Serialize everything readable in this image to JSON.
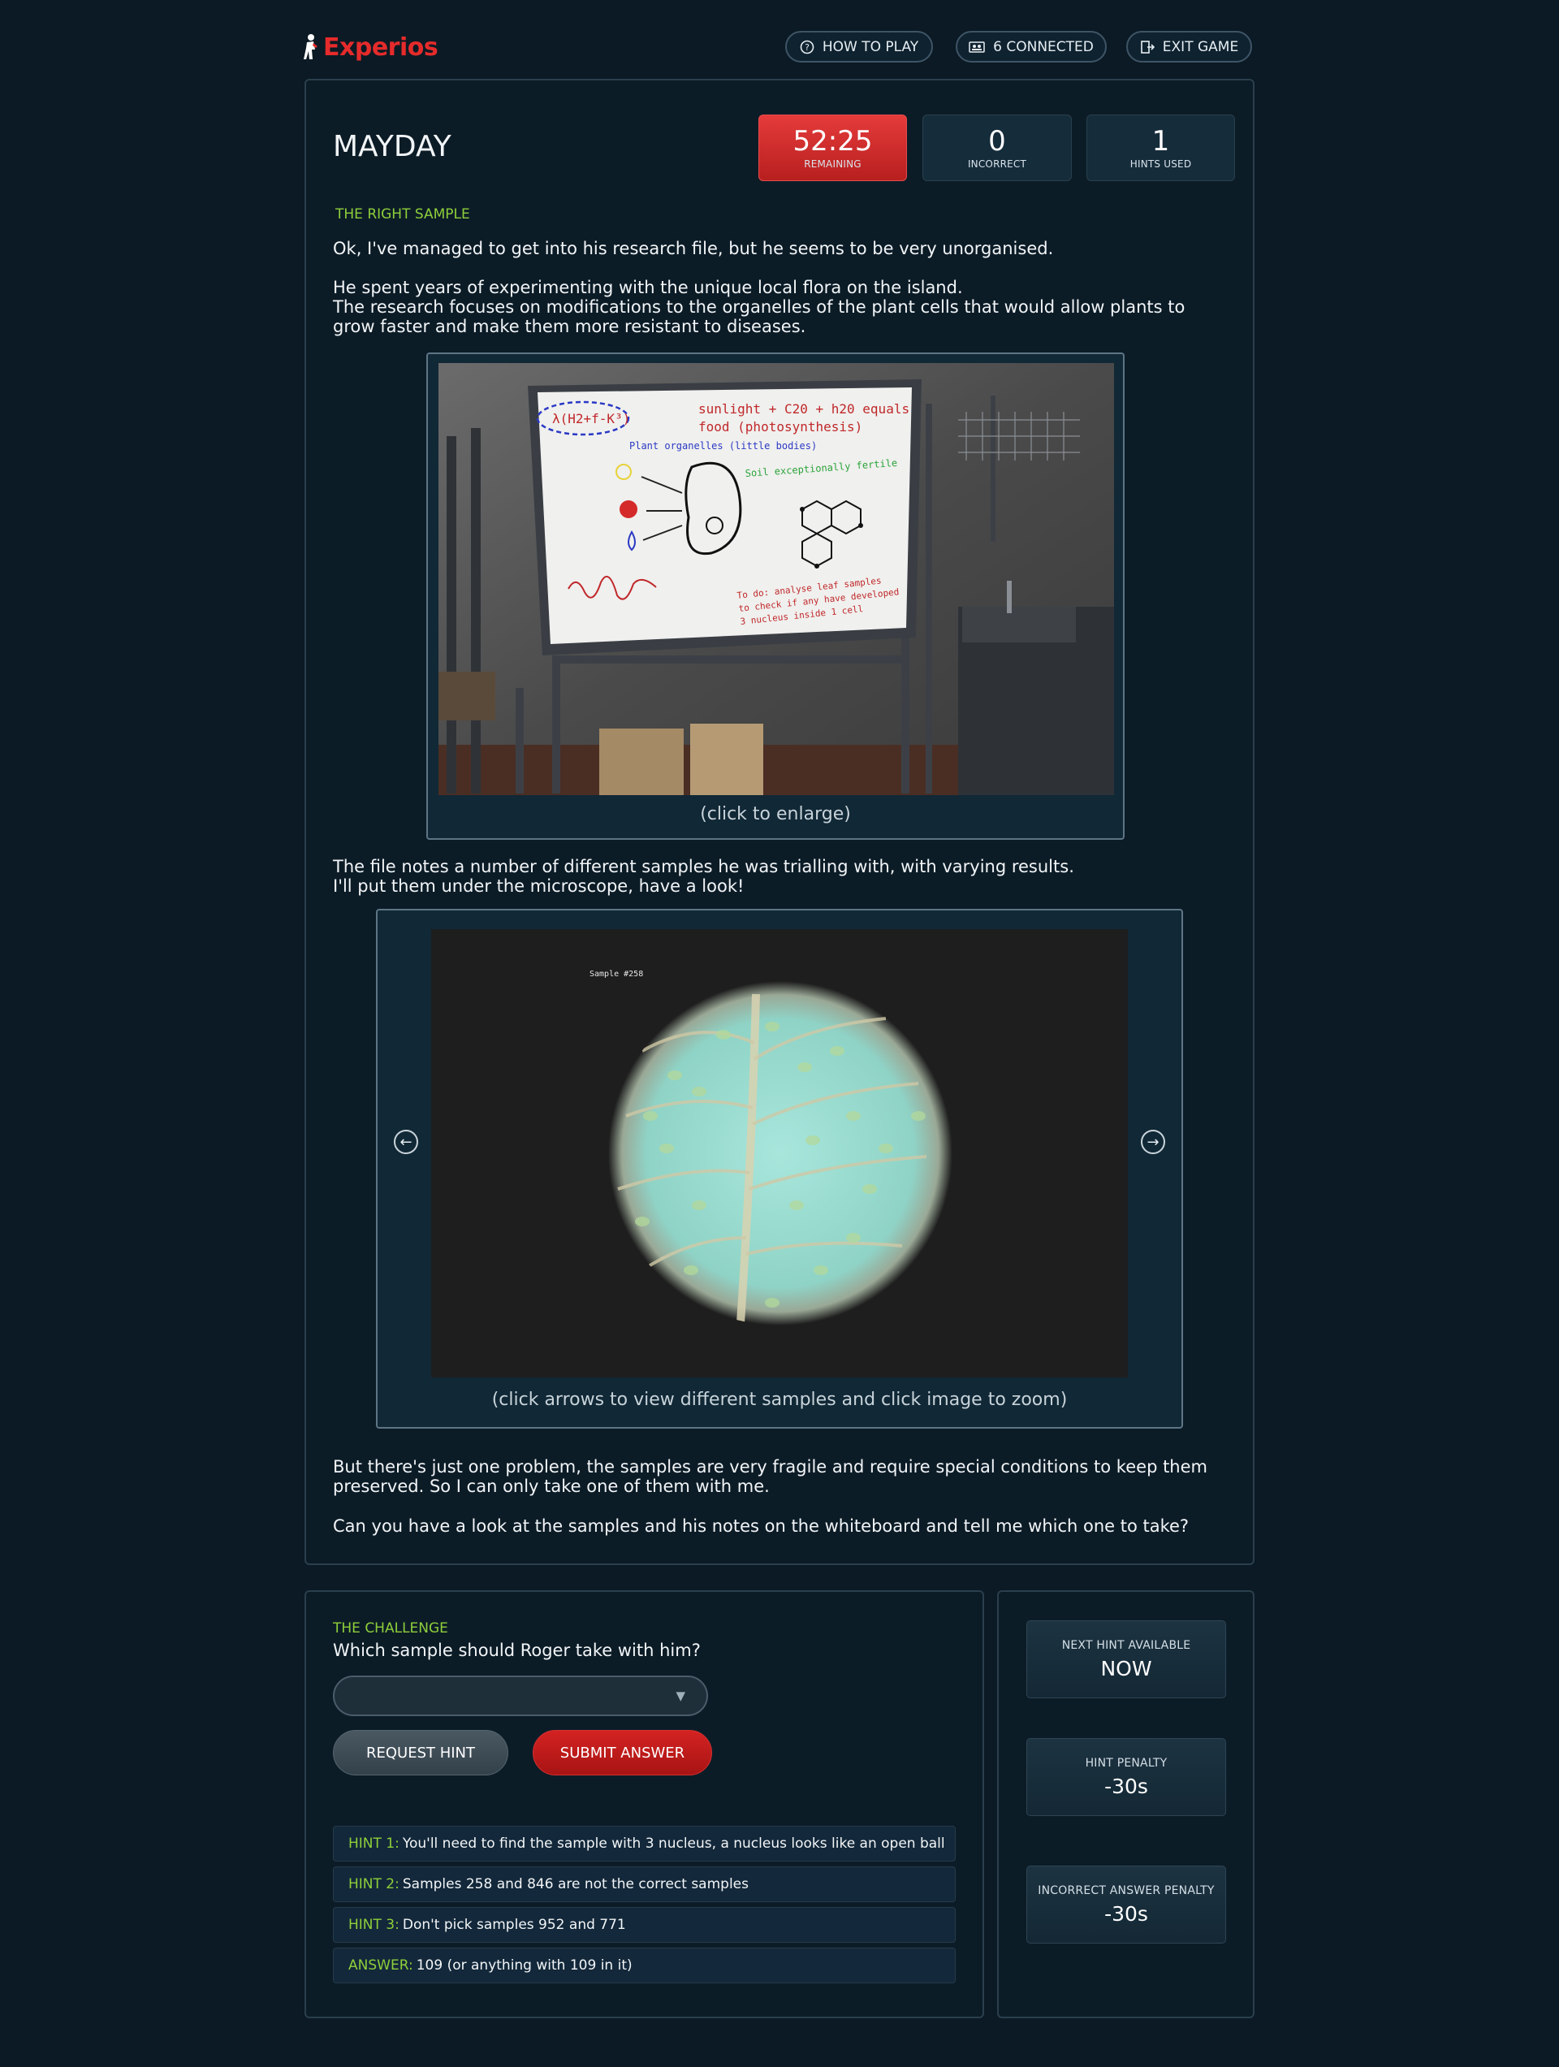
{
  "header": {
    "brand": "Experios",
    "how_to_play": "HOW TO PLAY",
    "connected": "6 CONNECTED",
    "exit": "EXIT GAME"
  },
  "game": {
    "title": "MAYDAY",
    "timer": "52:25",
    "timer_label": "REMAINING",
    "incorrect": "0",
    "incorrect_label": "INCORRECT",
    "hints_used": "1",
    "hints_used_label": "HINTS USED"
  },
  "story": {
    "section_label": "THE RIGHT SAMPLE",
    "p1": "Ok, I've managed to get into his research file, but he seems to be very unorganised.",
    "p2a": "He spent years of experimenting with the unique local flora on the island.",
    "p2b": "The research focuses on modifications to the organelles of the plant cells that would allow plants to grow faster and make them more resistant to diseases.",
    "image1_caption": "(click to enlarge)",
    "p3a": "The file notes a number of different samples he was trialling with, with varying results.",
    "p3b": "I'll put them under the microscope, have a look!",
    "sample_label": "Sample #258",
    "image2_caption": "(click arrows to view different samples and click image to zoom)",
    "p4": "But there's just one problem, the samples are very fragile and require special conditions to keep them preserved. So I can only take one of them with me.",
    "p5": "Can you have a look at the samples and his notes on the whiteboard and tell me which one to take?"
  },
  "whiteboard": {
    "eq1": "λ(H2+f-K³)",
    "eq2a": "sunlight + C20 + h20 equals",
    "eq2b": "food (photosynthesis)",
    "organelles": "Plant organelles (little bodies)",
    "soil": "Soil exceptionally fertile",
    "todo1": "To do: analyse leaf samples",
    "todo2": "to check if any have developed",
    "todo3": "3 nucleus inside 1 cell"
  },
  "challenge": {
    "label": "THE CHALLENGE",
    "question": "Which sample should Roger take with him?",
    "select_value": "",
    "request_hint": "REQUEST HINT",
    "submit": "SUBMIT ANSWER",
    "hints": [
      {
        "tag": "HINT 1:",
        "text": "You'll need to find the sample with 3 nucleus, a nucleus looks like an open ball"
      },
      {
        "tag": "HINT 2:",
        "text": "Samples 258 and 846 are not the correct samples"
      },
      {
        "tag": "HINT 3:",
        "text": "Don't pick samples 952 and 771"
      },
      {
        "tag": "ANSWER:",
        "text": "109 (or anything with 109 in it)"
      }
    ]
  },
  "sidebar": {
    "next_hint_label": "NEXT HINT AVAILABLE",
    "next_hint_value": "NOW",
    "hint_penalty_label": "HINT PENALTY",
    "hint_penalty_value": "-30s",
    "incorrect_penalty_label": "INCORRECT ANSWER PENALTY",
    "incorrect_penalty_value": "-30s"
  },
  "colors": {
    "accent_green": "#8ecf3a",
    "brand_red": "#e52b2b",
    "background": "#0b1a24"
  }
}
